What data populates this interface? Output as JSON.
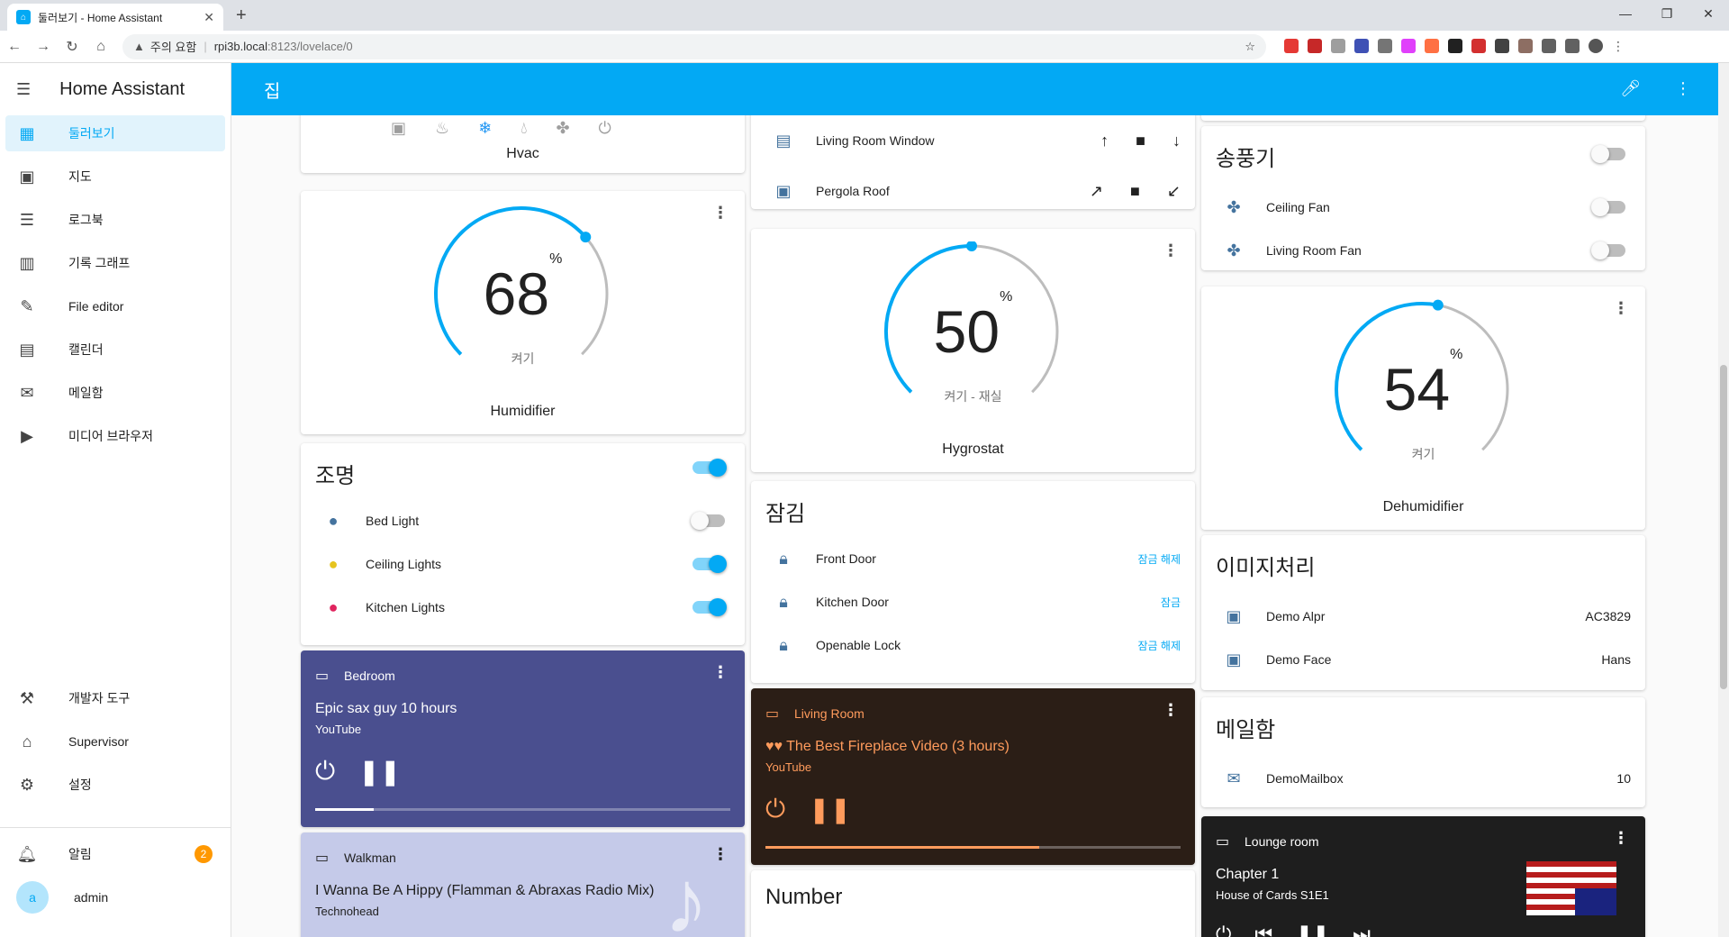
{
  "browser": {
    "tab_title": "둘러보기 - Home Assistant",
    "warning": "주의 요함",
    "url_host": "rpi3b.local",
    "url_rest": ":8123/lovelace/0"
  },
  "sidebar": {
    "title": "Home Assistant",
    "items": [
      {
        "label": "둘러보기",
        "icon": "dashboard-icon"
      },
      {
        "label": "지도",
        "icon": "map-icon"
      },
      {
        "label": "로그북",
        "icon": "logbook-icon"
      },
      {
        "label": "기록 그래프",
        "icon": "history-icon"
      },
      {
        "label": "File editor",
        "icon": "wrench-icon"
      },
      {
        "label": "캘린더",
        "icon": "calendar-icon"
      },
      {
        "label": "메일함",
        "icon": "mailbox-icon"
      },
      {
        "label": "미디어 브라우저",
        "icon": "media-icon"
      }
    ],
    "bottom": [
      {
        "label": "개발자 도구",
        "icon": "hammer-icon"
      },
      {
        "label": "Supervisor",
        "icon": "supervisor-icon"
      },
      {
        "label": "설정",
        "icon": "cog-icon"
      }
    ],
    "notifications": {
      "label": "알림",
      "count": "2"
    },
    "user": {
      "initial": "a",
      "name": "admin"
    }
  },
  "appbar": {
    "title": "집"
  },
  "hvac": {
    "name": "Hvac"
  },
  "covers": [
    {
      "name": "Living Room Window"
    },
    {
      "name": "Pergola Roof"
    }
  ],
  "fans": {
    "title": "송풍기",
    "items": [
      {
        "name": "Ceiling Fan"
      },
      {
        "name": "Living Room Fan"
      }
    ]
  },
  "humidifier": {
    "value": "68",
    "unit": "%",
    "state": "켜기",
    "name": "Humidifier",
    "level": 68
  },
  "hygrostat": {
    "value": "50",
    "unit": "%",
    "state": "켜기 - 재실",
    "name": "Hygrostat",
    "level": 50
  },
  "dehumidifier": {
    "value": "54",
    "unit": "%",
    "state": "켜기",
    "name": "Dehumidifier",
    "level": 54
  },
  "lights": {
    "title": "조명",
    "items": [
      {
        "name": "Bed Light",
        "on": false,
        "color": "#44739e"
      },
      {
        "name": "Ceiling Lights",
        "on": true,
        "color": "#e6c41e"
      },
      {
        "name": "Kitchen Lights",
        "on": true,
        "color": "#e0245e"
      }
    ]
  },
  "locks": {
    "title": "잠김",
    "items": [
      {
        "name": "Front Door",
        "action": "잠금 해제"
      },
      {
        "name": "Kitchen Door",
        "action": "잠금"
      },
      {
        "name": "Openable Lock",
        "action": "잠금 해제"
      }
    ]
  },
  "image_processing": {
    "title": "이미지처리",
    "items": [
      {
        "name": "Demo Alpr",
        "value": "AC3829"
      },
      {
        "name": "Demo Face",
        "value": "Hans"
      }
    ]
  },
  "mailbox": {
    "title": "메일함",
    "items": [
      {
        "name": "DemoMailbox",
        "value": "10"
      }
    ]
  },
  "media": {
    "bedroom": {
      "source": "Bedroom",
      "title": "Epic sax guy 10 hours",
      "artist": "YouTube",
      "progress": 0.14,
      "bg": "#4a4f8f"
    },
    "walkman": {
      "source": "Walkman",
      "title": "I Wanna Be A Hippy (Flamman & Abraxas Radio Mix)",
      "artist": "Technohead",
      "bg": "#c5cae9"
    },
    "living": {
      "source": "Living Room",
      "title": "♥♥ The Best Fireplace Video (3 hours)",
      "artist": "YouTube",
      "progress": 0.66,
      "bg": "#2b1e16",
      "accent": "#ff9b5c"
    },
    "lounge": {
      "source": "Lounge room",
      "title": "Chapter 1",
      "artist": "House of Cards S1E1",
      "bg": "#1e1e1e"
    }
  },
  "number": {
    "title": "Number"
  }
}
